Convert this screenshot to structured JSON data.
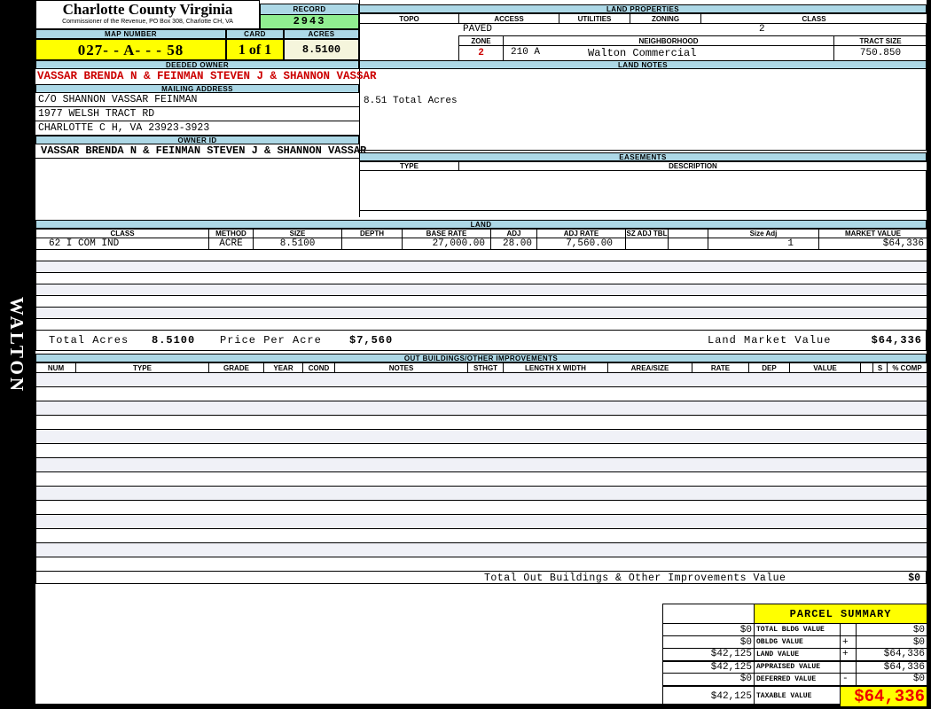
{
  "colors": {
    "band_blue": "#add8e6",
    "highlight_yellow": "#ffff00",
    "record_green": "#90ee90",
    "acres_cream": "#f5f5dc",
    "alert_red": "#cc0000"
  },
  "sidebar": {
    "vertical_label": "WALTON"
  },
  "header": {
    "county": "Charlotte County Virginia",
    "commissioner": "Commissioner of the Revenue, PO Box 308, Charlotte CH, VA",
    "record_label": "RECORD",
    "record_value": "2943",
    "map_number_label": "MAP NUMBER",
    "map_number_value": "027- - A- - - 58",
    "card_label": "CARD",
    "card_value": "1 of 1",
    "acres_label": "ACRES",
    "acres_value": "8.5100"
  },
  "owner": {
    "deeded_owner_label": "DEEDED OWNER",
    "deeded_owner_value": "VASSAR BRENDA N & FEINMAN STEVEN J & SHANNON VASSAR",
    "mailing_address_label": "MAILING ADDRESS",
    "mailing_line1": "C/O SHANNON VASSAR FEINMAN",
    "mailing_line2": "1977 WELSH TRACT RD",
    "mailing_line3": "CHARLOTTE C H, VA 23923-3923",
    "owner_id_label": "OWNER ID",
    "owner_id_value": "VASSAR BRENDA N & FEINMAN STEVEN J & SHANNON VASSAR"
  },
  "land_properties": {
    "title": "LAND PROPERTIES",
    "headers": [
      "TOPO",
      "ACCESS",
      "UTILITIES",
      "ZONING",
      "CLASS"
    ],
    "access_value": "PAVED",
    "class_value": "2",
    "zone_label": "ZONE",
    "zone_value": "2",
    "neighborhood_label": "NEIGHBORHOOD",
    "neighborhood_code": "210 A",
    "neighborhood_name": "Walton Commercial",
    "tract_size_label": "TRACT SIZE",
    "tract_size_value": "750.850"
  },
  "land_notes": {
    "title": "LAND NOTES",
    "note": "8.51 Total Acres"
  },
  "easements": {
    "title": "EASEMENTS",
    "type_label": "TYPE",
    "description_label": "DESCRIPTION"
  },
  "land_table": {
    "title": "LAND",
    "headers": [
      "CLASS",
      "METHOD",
      "SIZE",
      "DEPTH",
      "BASE RATE",
      "ADJ",
      "ADJ RATE",
      "SZ ADJ TBL",
      "",
      "Size Adj",
      "MARKET VALUE"
    ],
    "rows": [
      [
        "62 I COM IND",
        "ACRE",
        "8.5100",
        "",
        "27,000.00",
        "28.00",
        "7,560.00",
        "",
        "",
        "1",
        "$64,336"
      ]
    ],
    "totals": {
      "total_acres_label": "Total Acres",
      "total_acres_value": "8.5100",
      "price_per_acre_label": "Price Per Acre",
      "price_per_acre_value": "$7,560",
      "land_market_value_label": "Land Market Value",
      "land_market_value": "$64,336"
    }
  },
  "out_buildings": {
    "title": "OUT BUILDINGS/OTHER IMPROVEMENTS",
    "headers": [
      "NUM",
      "TYPE",
      "GRADE",
      "YEAR",
      "COND",
      "NOTES",
      "STHGT",
      "LENGTH X WIDTH",
      "AREA/SIZE",
      "RATE",
      "DEP",
      "VALUE",
      "",
      "S",
      "% COMP"
    ],
    "total_label": "Total Out Buildings & Other Improvements Value",
    "total_value": "$0"
  },
  "parcel_summary": {
    "title": "PARCEL SUMMARY",
    "rows": [
      {
        "prior": "$0",
        "label": "TOTAL BLDG VALUE",
        "op": "",
        "value": "$0"
      },
      {
        "prior": "$0",
        "label": "OBLDG VALUE",
        "op": "+",
        "value": "$0"
      },
      {
        "prior": "$42,125",
        "label": "LAND VALUE",
        "op": "+",
        "value": "$64,336"
      },
      {
        "prior": "$42,125",
        "label": "APPRAISED VALUE",
        "op": "",
        "value": "$64,336"
      },
      {
        "prior": "$0",
        "label": "DEFERRED VALUE",
        "op": "-",
        "value": "$0"
      }
    ],
    "taxable": {
      "prior": "$42,125",
      "label": "TAXABLE VALUE",
      "value": "$64,336"
    }
  }
}
